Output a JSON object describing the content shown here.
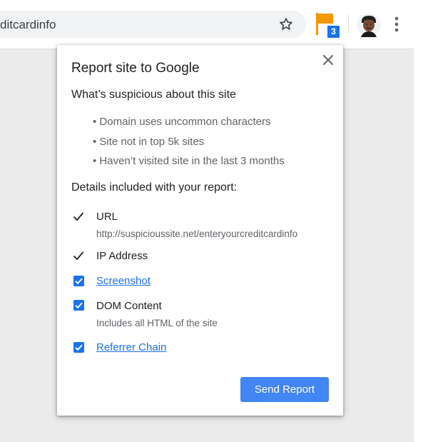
{
  "browser": {
    "omnibox_text": "ditcardinfo",
    "extension_badge_count": "3",
    "icons": {
      "bookmark": "star-outline-icon",
      "extension": "orange-flag-icon",
      "profile": "avatar",
      "menu": "vertical-dots-icon"
    }
  },
  "dialog": {
    "title": "Report site to Google",
    "suspicious_heading": "What’s suspicious about this site",
    "reasons": [
      "• Domain uses uncommon characters",
      "• Site not in top 5k sites",
      "• Haven’t visited site in the last 3 months"
    ],
    "details_heading": "Details included with your report:",
    "details": [
      {
        "label": "URL",
        "sub": "http://suspicioussite.net/enteryourcreditcardinfo",
        "control": "checkmark",
        "link": false
      },
      {
        "label": "IP Address",
        "sub": "",
        "control": "checkmark",
        "link": false
      },
      {
        "label": "Screenshot",
        "sub": "",
        "control": "checkbox-checked",
        "link": true
      },
      {
        "label": "DOM Content",
        "sub": "Includes all HTML of the site",
        "control": "checkbox-checked",
        "link": false
      },
      {
        "label": "Referrer Chain",
        "sub": "",
        "control": "checkbox-checked",
        "link": true
      }
    ],
    "send_button": "Send Report"
  },
  "colors": {
    "accent": "#1a73e8",
    "button": "#4285f4",
    "flag": "#f29900",
    "text_primary": "#202124",
    "text_secondary": "#5f6368",
    "page_background": "#ebebeb"
  }
}
